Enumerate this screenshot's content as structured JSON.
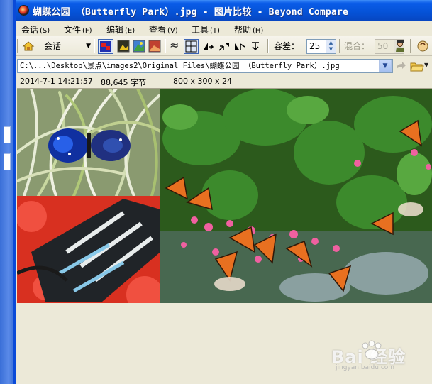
{
  "window": {
    "title": "蝴蝶公园 （Butterfly Park）.jpg - 图片比较 - Beyond Compare"
  },
  "menu": [
    {
      "label": "会话",
      "accel": "(S)"
    },
    {
      "label": "文件",
      "accel": "(F)"
    },
    {
      "label": "编辑",
      "accel": "(E)"
    },
    {
      "label": "查看",
      "accel": "(V)"
    },
    {
      "label": "工具",
      "accel": "(T)"
    },
    {
      "label": "帮助",
      "accel": "(H)"
    }
  ],
  "toolbar": {
    "session_label": "会话",
    "tolerance_label": "容差：",
    "tolerance_value": "25",
    "mix_label": "混合：",
    "mix_value": "50"
  },
  "file": {
    "path": "C:\\...\\Desktop\\景点\\images2\\Original Files\\蝴蝶公园 （Butterfly Park）.jpg",
    "modified": "2014-7-1 14:21:57",
    "size": "88,645 字节",
    "dimensions": "800 x 300 x 24"
  },
  "watermark": {
    "brand": "Bai  经验",
    "url": "jingyan.baidu.com"
  },
  "colors": {
    "titlebar": "#0552d6",
    "chrome": "#ece9d8",
    "path_border": "#7f9db9"
  }
}
